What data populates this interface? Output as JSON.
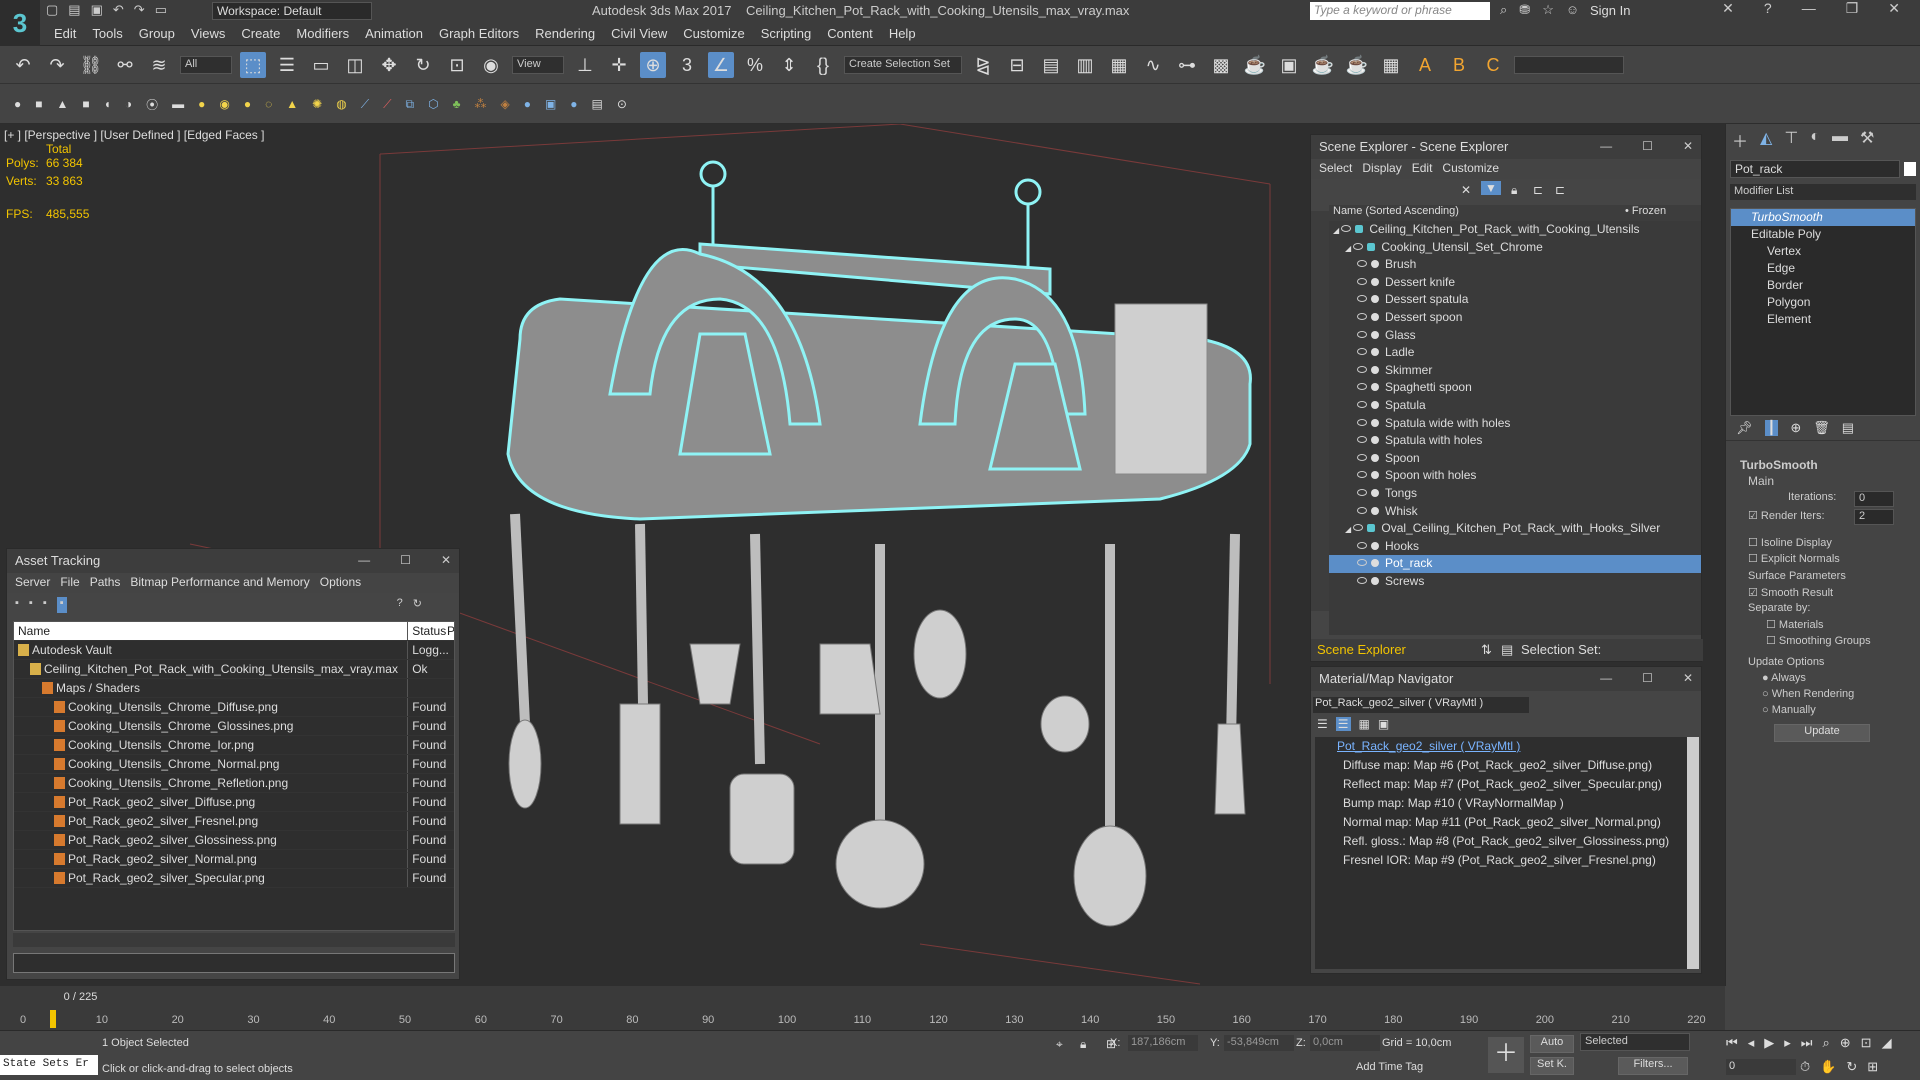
{
  "app": {
    "logo": "3",
    "workspace": "Workspace: Default",
    "title": "Autodesk 3ds Max 2017",
    "filename": "Ceiling_Kitchen_Pot_Rack_with_Cooking_Utensils_max_vray.max",
    "search_placeholder": "Type a keyword or phrase",
    "sign_in": "Sign In"
  },
  "menu": [
    "Edit",
    "Tools",
    "Group",
    "Views",
    "Create",
    "Modifiers",
    "Animation",
    "Graph Editors",
    "Rendering",
    "Civil View",
    "Customize",
    "Scripting",
    "Content",
    "Help"
  ],
  "toolbar": {
    "filter": "All",
    "ref_coord": "View",
    "selection_set": "Create Selection Set"
  },
  "viewport": {
    "label": "[+ ] [Perspective ] [User Defined ] [Edged Faces ]",
    "total_label": "Total",
    "polys_label": "Polys:",
    "polys_value": "66 384",
    "verts_label": "Verts:",
    "verts_value": "33 863",
    "fps_label": "FPS:",
    "fps_value": "485,555"
  },
  "asset_tracking": {
    "title": "Asset Tracking",
    "menu": [
      "Server",
      "File",
      "Paths",
      "Bitmap Performance and Memory",
      "Options"
    ],
    "col_name": "Name",
    "col_status": "Status",
    "col_p": "P",
    "rows": [
      {
        "name": "Autodesk Vault",
        "status": "Logg...",
        "indent": 0
      },
      {
        "name": "Ceiling_Kitchen_Pot_Rack_with_Cooking_Utensils_max_vray.max",
        "status": "Ok",
        "indent": 1
      },
      {
        "name": "Maps / Shaders",
        "status": "",
        "indent": 2
      },
      {
        "name": "Cooking_Utensils_Chrome_Diffuse.png",
        "status": "Found",
        "indent": 3
      },
      {
        "name": "Cooking_Utensils_Chrome_Glossines.png",
        "status": "Found",
        "indent": 3
      },
      {
        "name": "Cooking_Utensils_Chrome_Ior.png",
        "status": "Found",
        "indent": 3
      },
      {
        "name": "Cooking_Utensils_Chrome_Normal.png",
        "status": "Found",
        "indent": 3
      },
      {
        "name": "Cooking_Utensils_Chrome_Refletion.png",
        "status": "Found",
        "indent": 3
      },
      {
        "name": "Pot_Rack_geo2_silver_Diffuse.png",
        "status": "Found",
        "indent": 3
      },
      {
        "name": "Pot_Rack_geo2_silver_Fresnel.png",
        "status": "Found",
        "indent": 3
      },
      {
        "name": "Pot_Rack_geo2_silver_Glossiness.png",
        "status": "Found",
        "indent": 3
      },
      {
        "name": "Pot_Rack_geo2_silver_Normal.png",
        "status": "Found",
        "indent": 3
      },
      {
        "name": "Pot_Rack_geo2_silver_Specular.png",
        "status": "Found",
        "indent": 3
      }
    ]
  },
  "scene_explorer": {
    "title": "Scene Explorer - Scene Explorer",
    "menu": [
      "Select",
      "Display",
      "Edit",
      "Customize"
    ],
    "col_name": "Name (Sorted Ascending)",
    "col_frozen": "• Frozen",
    "footer_left": "Scene Explorer",
    "footer_right": "Selection Set:",
    "rows": [
      {
        "name": "Ceiling_Kitchen_Pot_Rack_with_Cooking_Utensils",
        "level": 0,
        "selected": false
      },
      {
        "name": "Cooking_Utensil_Set_Chrome",
        "level": 1,
        "selected": false
      },
      {
        "name": "Brush",
        "level": 2,
        "selected": false
      },
      {
        "name": "Dessert knife",
        "level": 2,
        "selected": false
      },
      {
        "name": "Dessert spatula",
        "level": 2,
        "selected": false
      },
      {
        "name": "Dessert spoon",
        "level": 2,
        "selected": false
      },
      {
        "name": "Glass",
        "level": 2,
        "selected": false
      },
      {
        "name": "Ladle",
        "level": 2,
        "selected": false
      },
      {
        "name": "Skimmer",
        "level": 2,
        "selected": false
      },
      {
        "name": "Spaghetti spoon",
        "level": 2,
        "selected": false
      },
      {
        "name": "Spatula",
        "level": 2,
        "selected": false
      },
      {
        "name": "Spatula wide with holes",
        "level": 2,
        "selected": false
      },
      {
        "name": "Spatula with holes",
        "level": 2,
        "selected": false
      },
      {
        "name": "Spoon",
        "level": 2,
        "selected": false
      },
      {
        "name": "Spoon with holes",
        "level": 2,
        "selected": false
      },
      {
        "name": "Tongs",
        "level": 2,
        "selected": false
      },
      {
        "name": "Whisk",
        "level": 2,
        "selected": false
      },
      {
        "name": "Oval_Ceiling_Kitchen_Pot_Rack_with_Hooks_Silver",
        "level": 1,
        "selected": false
      },
      {
        "name": "Hooks",
        "level": 2,
        "selected": false
      },
      {
        "name": "Pot_rack",
        "level": 2,
        "selected": true
      },
      {
        "name": "Screws",
        "level": 2,
        "selected": false
      }
    ]
  },
  "material_navigator": {
    "title": "Material/Map Navigator",
    "current": "Pot_Rack_geo2_silver  ( VRayMtl )",
    "header": "Pot_Rack_geo2_silver  ( VRayMtl )",
    "rows": [
      "Diffuse map: Map #6 (Pot_Rack_geo2_silver_Diffuse.png)",
      "Reflect map: Map #7 (Pot_Rack_geo2_silver_Specular.png)",
      "Bump map: Map #10  ( VRayNormalMap )",
      "Normal map: Map #11 (Pot_Rack_geo2_silver_Normal.png)",
      "Refl. gloss.: Map #8 (Pot_Rack_geo2_silver_Glossiness.png)",
      "Fresnel IOR: Map #9 (Pot_Rack_geo2_silver_Fresnel.png)"
    ]
  },
  "command_panel": {
    "object_name": "Pot_rack",
    "modifier_list": "Modifier List",
    "stack": [
      "TurboSmooth",
      "Editable Poly",
      "Vertex",
      "Edge",
      "Border",
      "Polygon",
      "Element"
    ],
    "turbosmooth": {
      "title": "TurboSmooth",
      "main": "Main",
      "iterations_label": "Iterations:",
      "iterations": "0",
      "render_iters_label": "Render Iters:",
      "render_iters": "2",
      "isoline": "Isoline Display",
      "explicit": "Explicit Normals",
      "surface": "Surface Parameters",
      "smooth_result": "Smooth Result",
      "separate": "Separate by:",
      "materials": "Materials",
      "smoothing_groups": "Smoothing Groups",
      "update_options": "Update Options",
      "always": "Always",
      "when_rendering": "When Rendering",
      "manually": "Manually",
      "update_btn": "Update"
    }
  },
  "timeline": {
    "frame": "0 / 225",
    "ticks": [
      "0",
      "10",
      "20",
      "30",
      "40",
      "50",
      "60",
      "70",
      "80",
      "90",
      "100",
      "110",
      "120",
      "130",
      "140",
      "150",
      "160",
      "170",
      "180",
      "190",
      "200",
      "210",
      "220"
    ]
  },
  "status": {
    "state_sets": "State Sets Er",
    "selected": "1 Object Selected",
    "hint": "Click or click-and-drag to select objects",
    "x_label": "X:",
    "x_value": "187,186cm",
    "y_label": "Y:",
    "y_value": "-53,849cm",
    "z_label": "Z:",
    "z_value": "0,0cm",
    "grid": "Grid = 10,0cm",
    "add_time_tag": "Add Time Tag",
    "auto": "Auto",
    "set_key": "Set K.",
    "selected_dd": "Selected",
    "filters": "Filters...",
    "frame_field": "0"
  },
  "colors": {
    "accent": "#5b8ec8",
    "wire": "#8ff3f5",
    "stats": "#f2c400"
  }
}
